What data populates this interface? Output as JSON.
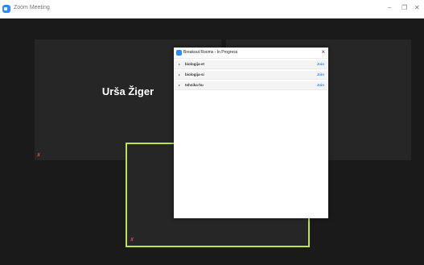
{
  "window": {
    "title": "Zoom Meeting",
    "min_glyph": "–",
    "max_glyph": "❐",
    "close_glyph": "✕"
  },
  "tiles": {
    "participant_name": "Urša Žiger",
    "muted_icon": "mic-muted-icon"
  },
  "breakout_dialog": {
    "title": "Breakout Rooms - In Progress",
    "close_glyph": "×",
    "rooms": [
      {
        "name": "biologija-et",
        "action": "Join"
      },
      {
        "name": "biologija-si",
        "action": "Join"
      },
      {
        "name": "tehnika-hu",
        "action": "Join"
      }
    ]
  },
  "colors": {
    "accent": "#2d8cff",
    "active_speaker_border": "#bde157",
    "muted": "#e0463e"
  }
}
